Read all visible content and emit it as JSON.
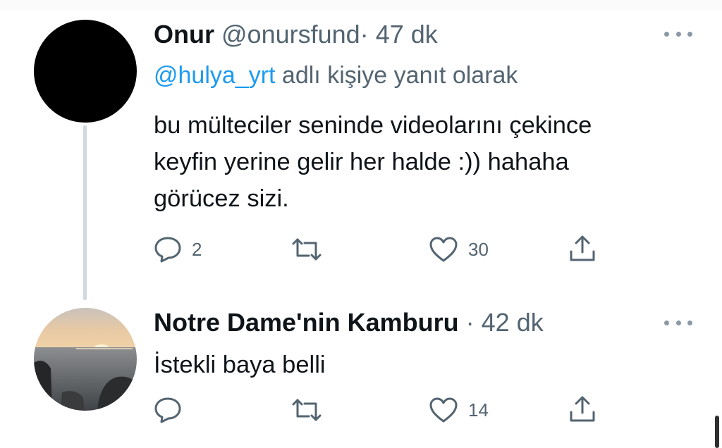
{
  "tweets": [
    {
      "name": "Onur",
      "handle": "@onursfund",
      "time": "47 dk",
      "replying_mention": "@hulya_yrt",
      "replying_suffix": " adlı kişiye yanıt olarak",
      "text": "bu mülteciler seninde videolarını çekince\nkeyfin yerine gelir her halde :)) hahaha\ngörücez sizi.",
      "reply_count": "2",
      "retweet_count": "",
      "like_count": "30"
    },
    {
      "name": "Notre Dame'nin Kamburu",
      "handle": "",
      "time": "42 dk",
      "text": "İstekli baya belli",
      "reply_count": "",
      "retweet_count": "",
      "like_count": "14"
    }
  ],
  "separator": "·",
  "icons": {
    "more": "more-horizontal-icon",
    "reply": "reply-bubble-icon",
    "retweet": "retweet-icon",
    "like": "heart-icon",
    "share": "share-upload-icon"
  },
  "colors": {
    "text": "#0f1419",
    "secondary": "#536471",
    "link": "#1d9bf0",
    "thread_line": "#cfd9de"
  }
}
